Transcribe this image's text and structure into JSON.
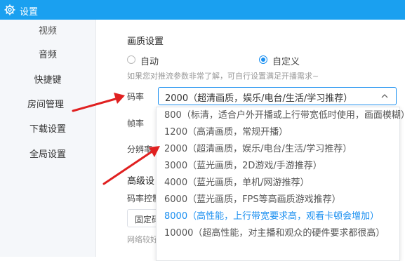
{
  "titlebar": {
    "title": "设置"
  },
  "sidebar": {
    "items": [
      {
        "label": "视频"
      },
      {
        "label": "音频"
      },
      {
        "label": "快捷键"
      },
      {
        "label": "房间管理"
      },
      {
        "label": "下载设置"
      },
      {
        "label": "全局设置"
      }
    ]
  },
  "quality": {
    "heading": "画质设置",
    "auto_label": "自动",
    "custom_label": "自定义",
    "hint": "如果您对推流参数非常了解，可自行设置满足开播需求~",
    "bitrate_label": "码率",
    "framerate_label": "帧率",
    "resolution_label": "分辨率",
    "bitrate_selected": "2000（超清画质，娱乐/电台/生活/学习推荐）"
  },
  "bitrate_options": [
    {
      "label": "800（标清，适合户外开播或上行带宽低时使用，画面模糊）"
    },
    {
      "label": "1200（高清画质，常规开播）"
    },
    {
      "label": "2000（超清画质，娱乐/电台/生活/学习推荐）"
    },
    {
      "label": "3000（蓝光画质，2D游戏/手游推荐）"
    },
    {
      "label": "4000（蓝光画质，单机/网游推荐）"
    },
    {
      "label": "6000（蓝光画质，FPS等高画质游戏推荐）"
    },
    {
      "label": "8000（高性能，上行带宽要求高，观看卡顿会增加）"
    },
    {
      "label": "10000（超高性能，对主播和观众的硬件要求都很高）"
    }
  ],
  "advanced": {
    "heading": "高级设",
    "bitrate_control_label": "码率控制",
    "fixed_value": "固定码",
    "network_hint": "网络较好"
  },
  "colors": {
    "accent": "#1a8ff0",
    "titlebar": "#1aa0f0",
    "annotation_arrow": "#e02020"
  }
}
